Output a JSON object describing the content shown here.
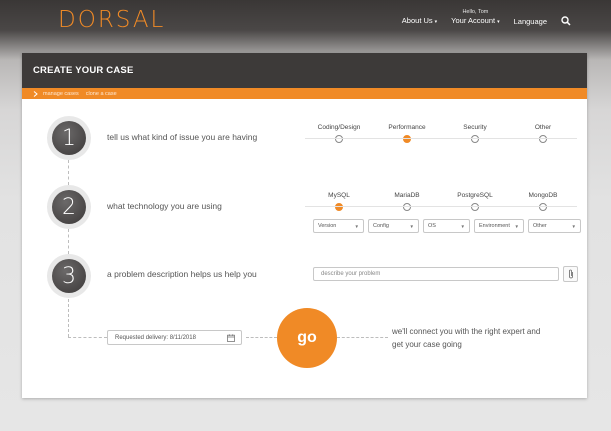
{
  "brand": {
    "logo_text": "DORSAL"
  },
  "nav": {
    "about": "About Us",
    "greeting": "Hello, Tom",
    "account": "Your Account",
    "language": "Language"
  },
  "panel": {
    "title": "CREATE YOUR CASE",
    "breadcrumbs": [
      "manage cases",
      "clone a case"
    ]
  },
  "steps": [
    {
      "number": "1",
      "text": "tell us what kind of issue you are having"
    },
    {
      "number": "2",
      "text": "what technology you are using"
    },
    {
      "number": "3",
      "text": "a problem description helps us help you"
    }
  ],
  "issue_types": [
    {
      "label": "Coding/Design",
      "selected": false
    },
    {
      "label": "Performance",
      "selected": true
    },
    {
      "label": "Security",
      "selected": false
    },
    {
      "label": "Other",
      "selected": false
    }
  ],
  "technologies": [
    {
      "label": "MySQL",
      "selected": true
    },
    {
      "label": "MariaDB",
      "selected": false
    },
    {
      "label": "PostgreSQL",
      "selected": false
    },
    {
      "label": "MongoDB",
      "selected": false
    }
  ],
  "selects": [
    {
      "value": "Version"
    },
    {
      "value": "Config"
    },
    {
      "value": "OS"
    },
    {
      "value": "Environment"
    },
    {
      "value": "Other"
    }
  ],
  "description": {
    "placeholder": "describe your problem"
  },
  "delivery": {
    "value": "Requested delivery: 8/11/2018"
  },
  "go": {
    "label": "go",
    "text": "we'll connect you with the right expert and get your case going"
  },
  "colors": {
    "accent": "#f08a26",
    "header": "#3d3a39"
  }
}
